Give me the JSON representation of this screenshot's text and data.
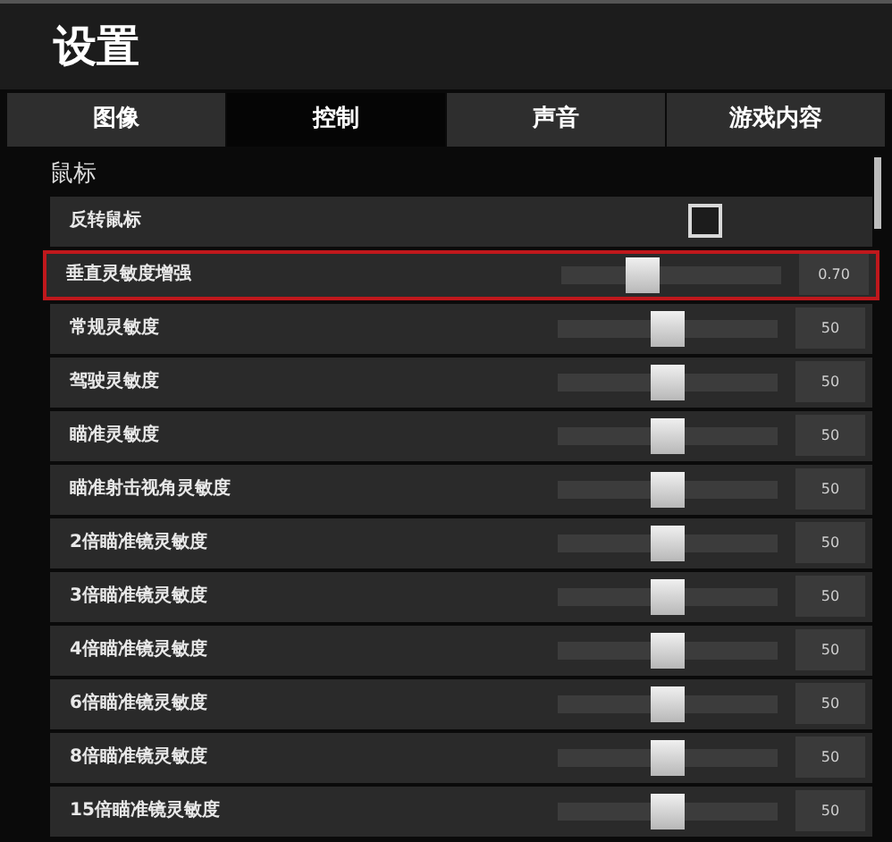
{
  "title": "设置",
  "tabs": [
    {
      "label": "图像",
      "selected": false
    },
    {
      "label": "控制",
      "selected": true
    },
    {
      "label": "声音",
      "selected": false
    },
    {
      "label": "游戏内容",
      "selected": false
    }
  ],
  "section": {
    "title": "鼠标",
    "rows": [
      {
        "kind": "checkbox",
        "label": "反转鼠标",
        "checked": false,
        "highlighted": false
      },
      {
        "kind": "slider",
        "label": "垂直灵敏度增强",
        "level": 0.35,
        "value": "0.70",
        "highlighted": true
      },
      {
        "kind": "slider",
        "label": "常规灵敏度",
        "level": 0.5,
        "value": "50",
        "highlighted": false
      },
      {
        "kind": "slider",
        "label": "驾驶灵敏度",
        "level": 0.5,
        "value": "50",
        "highlighted": false
      },
      {
        "kind": "slider",
        "label": "瞄准灵敏度",
        "level": 0.5,
        "value": "50",
        "highlighted": false
      },
      {
        "kind": "slider",
        "label": "瞄准射击视角灵敏度",
        "level": 0.5,
        "value": "50",
        "highlighted": false
      },
      {
        "kind": "slider",
        "label": "2倍瞄准镜灵敏度",
        "level": 0.5,
        "value": "50",
        "highlighted": false
      },
      {
        "kind": "slider",
        "label": "3倍瞄准镜灵敏度",
        "level": 0.5,
        "value": "50",
        "highlighted": false
      },
      {
        "kind": "slider",
        "label": "4倍瞄准镜灵敏度",
        "level": 0.5,
        "value": "50",
        "highlighted": false
      },
      {
        "kind": "slider",
        "label": "6倍瞄准镜灵敏度",
        "level": 0.5,
        "value": "50",
        "highlighted": false
      },
      {
        "kind": "slider",
        "label": "8倍瞄准镜灵敏度",
        "level": 0.5,
        "value": "50",
        "highlighted": false
      },
      {
        "kind": "slider",
        "label": "15倍瞄准镜灵敏度",
        "level": 0.5,
        "value": "50",
        "highlighted": false
      }
    ]
  }
}
